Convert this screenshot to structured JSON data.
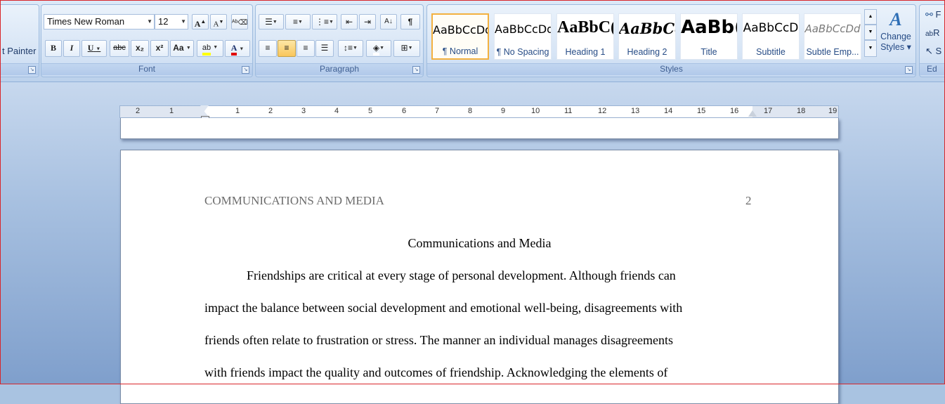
{
  "clipboard": {
    "format_painter_label": "t Painter"
  },
  "font": {
    "group_label": "Font",
    "font_name": "Times New Roman",
    "font_size": "12",
    "grow_label": "A",
    "shrink_label": "A",
    "bold_label": "B",
    "italic_label": "I",
    "underline_label": "U",
    "strike_label": "abc",
    "subscript_label": "x₂",
    "superscript_label": "x²",
    "case_label": "Aa",
    "highlight_label": "ab",
    "font_color_label": "A",
    "highlight_color": "#ffff00",
    "font_color": "#e00000"
  },
  "paragraph": {
    "group_label": "Paragraph",
    "show_marks_label": "¶"
  },
  "styles": {
    "group_label": "Styles",
    "items": [
      {
        "preview": "AaBbCcDd",
        "name": "¶ Normal"
      },
      {
        "preview": "AaBbCcDd",
        "name": "¶ No Spacing"
      },
      {
        "preview": "AaBbC(",
        "name": "Heading 1"
      },
      {
        "preview": "AaBbCc",
        "name": "Heading 2"
      },
      {
        "preview": "AaBb(",
        "name": "Title"
      },
      {
        "preview": "AaBbCcD",
        "name": "Subtitle"
      },
      {
        "preview": "AaBbCcDd",
        "name": "Subtle Emp..."
      }
    ],
    "change_styles_line1": "Change",
    "change_styles_line2": "Styles ▾"
  },
  "editing": {
    "group_label": "Ed",
    "find_label": "F",
    "replace_label": "R",
    "select_label": "S"
  },
  "ruler": {
    "left_numbers": [
      "2",
      "1"
    ],
    "right_numbers": [
      "1",
      "2",
      "3",
      "4",
      "5",
      "6",
      "7",
      "8",
      "9",
      "10",
      "11",
      "12",
      "13",
      "14",
      "15",
      "16",
      "17",
      "18",
      "19"
    ]
  },
  "document": {
    "header_title": "COMMUNICATIONS AND MEDIA",
    "page_number": "2",
    "title": "Communications and Media",
    "lines": [
      "Friendships are critical at every stage of personal development. Although friends can",
      "impact the balance between social development and emotional well-being, disagreements with",
      "friends often relate to frustration or stress. The manner an individual manages disagreements",
      "with friends impact the quality and outcomes of friendship. Acknowledging the elements of"
    ]
  }
}
